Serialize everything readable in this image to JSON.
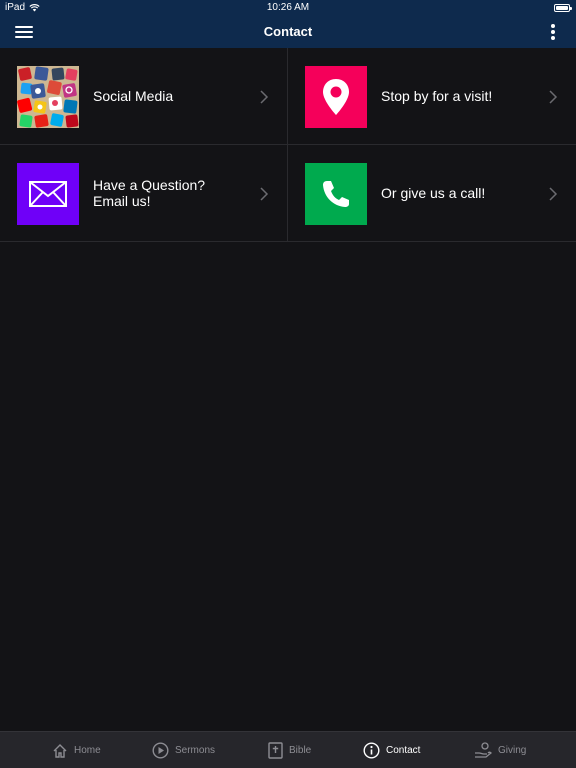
{
  "status_bar": {
    "device": "iPad",
    "time": "10:26 AM"
  },
  "nav": {
    "title": "Contact"
  },
  "tiles": [
    {
      "label_line1": "Social Media",
      "label_line2": "",
      "icon": "social-media-collage-icon"
    },
    {
      "label_line1": "Stop by for a visit!",
      "label_line2": "",
      "icon": "map-pin-icon",
      "color": "#f5005a"
    },
    {
      "label_line1": "Have a Question?",
      "label_line2": "Email us!",
      "icon": "envelope-icon",
      "color": "#6f00f8"
    },
    {
      "label_line1": "Or give us a call!",
      "label_line2": "",
      "icon": "phone-icon",
      "color": "#00aa4e"
    }
  ],
  "tabs": [
    {
      "label": "Home",
      "icon": "home-icon"
    },
    {
      "label": "Sermons",
      "icon": "play-circle-icon"
    },
    {
      "label": "Bible",
      "icon": "bible-icon"
    },
    {
      "label": "Contact",
      "icon": "info-icon",
      "active": true
    },
    {
      "label": "Giving",
      "icon": "giving-hand-icon"
    }
  ],
  "colors": {
    "nav_background": "#0e2a4d",
    "page_background": "#131316",
    "tab_bar_background": "#26262b"
  }
}
